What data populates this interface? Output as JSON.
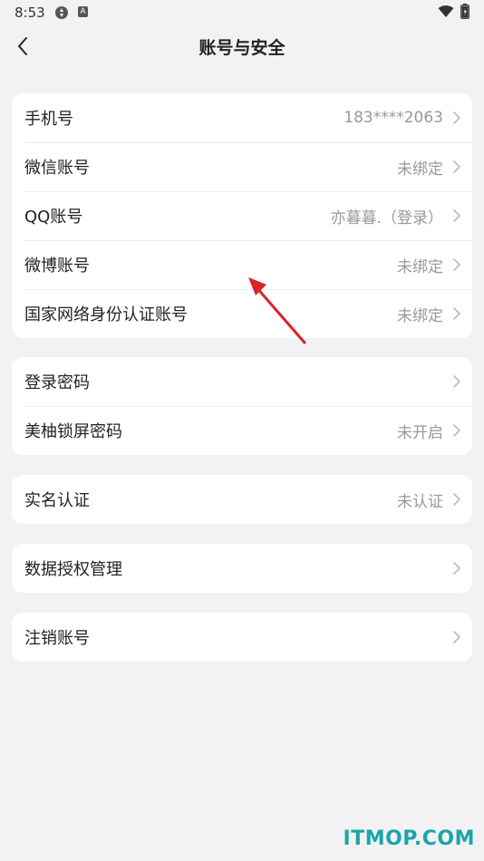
{
  "status_bar": {
    "time": "8:53",
    "icon_left": "settings-sync-icon",
    "icon_a": "A",
    "wifi": "wifi-icon",
    "battery": "battery-charging-icon"
  },
  "header": {
    "title": "账号与安全",
    "back_icon": "chevron-left-icon"
  },
  "groups": [
    {
      "rows": [
        {
          "label": "手机号",
          "value": "183****2063"
        },
        {
          "label": "微信账号",
          "value": "未绑定"
        },
        {
          "label": "QQ账号",
          "value": "亦暮暮.（登录）"
        },
        {
          "label": "微博账号",
          "value": "未绑定"
        },
        {
          "label": "国家网络身份认证账号",
          "value": "未绑定"
        }
      ]
    },
    {
      "rows": [
        {
          "label": "登录密码",
          "value": ""
        },
        {
          "label": "美柚锁屏密码",
          "value": "未开启"
        }
      ]
    },
    {
      "rows": [
        {
          "label": "实名认证",
          "value": "未认证"
        }
      ]
    },
    {
      "rows": [
        {
          "label": "数据授权管理",
          "value": ""
        }
      ]
    },
    {
      "rows": [
        {
          "label": "注销账号",
          "value": ""
        }
      ]
    }
  ],
  "watermark": "ITMOP.COM",
  "colors": {
    "background": "#f2f2f4",
    "card": "#ffffff",
    "value_text": "#999999",
    "arrow": "#d9232d",
    "watermark": "#1aa6a6"
  }
}
